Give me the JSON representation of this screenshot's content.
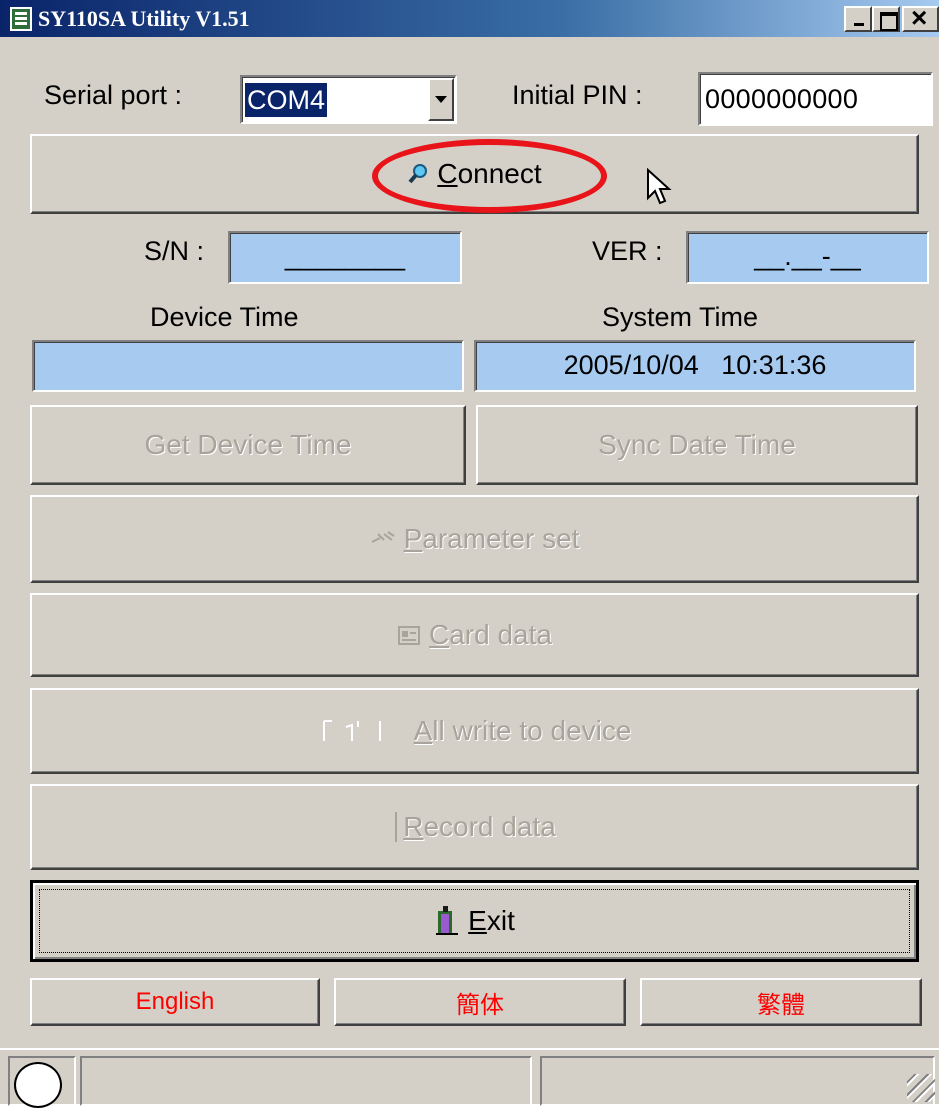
{
  "window": {
    "title": "SY110SA Utility V1.51"
  },
  "serial": {
    "label": "Serial port :",
    "value": "COM4"
  },
  "pin": {
    "label": "Initial PIN :",
    "value": "0000000000"
  },
  "buttons": {
    "connect_prefix": "C",
    "connect_rest": "onnect",
    "get_device_time": "Get Device Time",
    "sync_date_time": "Sync Date Time",
    "parameter_prefix": "P",
    "parameter_rest": "arameter set",
    "card_prefix": "C",
    "card_rest": "ard data",
    "allwrite_prefix": "A",
    "allwrite_rest": "ll write to device",
    "record_prefix": "R",
    "record_rest": "ecord data",
    "exit_prefix": "E",
    "exit_rest": "xit"
  },
  "info": {
    "sn_label": "S/N :",
    "sn_value": "________",
    "ver_label": "VER :",
    "ver_value": "__.__-__",
    "device_time_label": "Device Time",
    "device_time_value": "",
    "system_time_label": "System Time",
    "system_time_value": "2005/10/04   10:31:36"
  },
  "languages": {
    "english": "English",
    "simplified": "簡体",
    "traditional": "繁體"
  },
  "colors": {
    "titlebar_start": "#0a246a",
    "titlebar_end": "#a6caf0",
    "field_blue": "#a6caf0",
    "lang_text": "#ff0000",
    "highlight_circle": "#e8141a"
  },
  "icons": [
    "app-icon",
    "magnifier-icon",
    "wrench-icon",
    "card-icon",
    "write-icon",
    "record-icon",
    "exit-door-icon",
    "status-indicator-icon"
  ]
}
